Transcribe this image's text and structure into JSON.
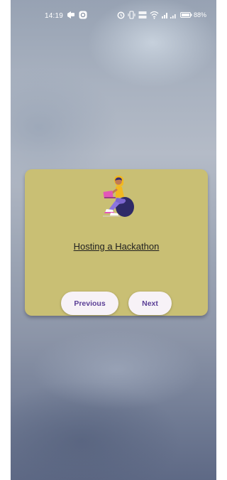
{
  "status_bar": {
    "time": "14:19",
    "battery_percent": "88%",
    "left_icons": [
      "notification-icon",
      "app-badge-icon"
    ],
    "right_icons": [
      "alarm-icon",
      "vibrate-icon",
      "volte-icon",
      "wifi-icon",
      "signal-icon",
      "battery-icon"
    ]
  },
  "card": {
    "title": "Hosting a Hackathon",
    "illustration": "person-with-laptop-illustration",
    "background_color": "#c9bf74"
  },
  "buttons": {
    "previous_label": "Previous",
    "next_label": "Next",
    "text_color": "#5b3f96"
  }
}
